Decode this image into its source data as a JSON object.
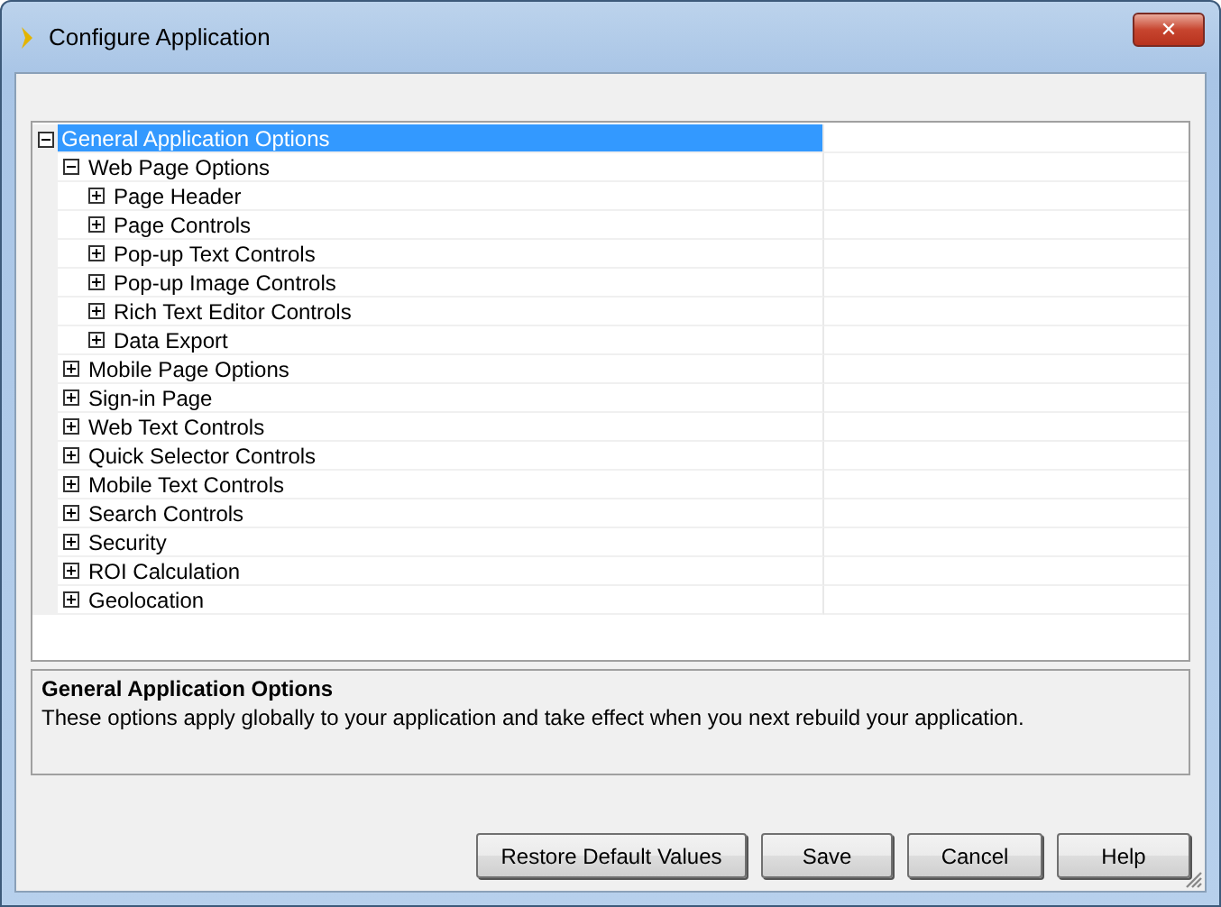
{
  "window": {
    "title": "Configure Application",
    "close": "✕"
  },
  "tree": [
    {
      "label": "General Application Options",
      "expanded": true,
      "selected": true,
      "children": [
        {
          "label": "Web Page Options",
          "expanded": true,
          "selected": false,
          "children": [
            {
              "label": "Page Header",
              "expanded": false,
              "selected": false
            },
            {
              "label": "Page Controls",
              "expanded": false,
              "selected": false
            },
            {
              "label": "Pop-up Text Controls",
              "expanded": false,
              "selected": false
            },
            {
              "label": "Pop-up Image Controls",
              "expanded": false,
              "selected": false
            },
            {
              "label": "Rich Text Editor Controls",
              "expanded": false,
              "selected": false
            },
            {
              "label": "Data Export",
              "expanded": false,
              "selected": false
            }
          ]
        },
        {
          "label": "Mobile Page Options",
          "expanded": false,
          "selected": false
        },
        {
          "label": "Sign-in Page",
          "expanded": false,
          "selected": false
        },
        {
          "label": "Web Text Controls",
          "expanded": false,
          "selected": false
        },
        {
          "label": "Quick Selector Controls",
          "expanded": false,
          "selected": false
        },
        {
          "label": "Mobile Text Controls",
          "expanded": false,
          "selected": false
        },
        {
          "label": "Search Controls",
          "expanded": false,
          "selected": false
        },
        {
          "label": "Security",
          "expanded": false,
          "selected": false
        },
        {
          "label": "ROI Calculation",
          "expanded": false,
          "selected": false
        },
        {
          "label": "Geolocation",
          "expanded": false,
          "selected": false
        }
      ]
    }
  ],
  "description": {
    "title": "General Application Options",
    "text": "These options apply globally to your application and take effect when you next rebuild your application."
  },
  "buttons": [
    "Restore Default Values",
    "Save",
    "Cancel",
    "Help"
  ]
}
